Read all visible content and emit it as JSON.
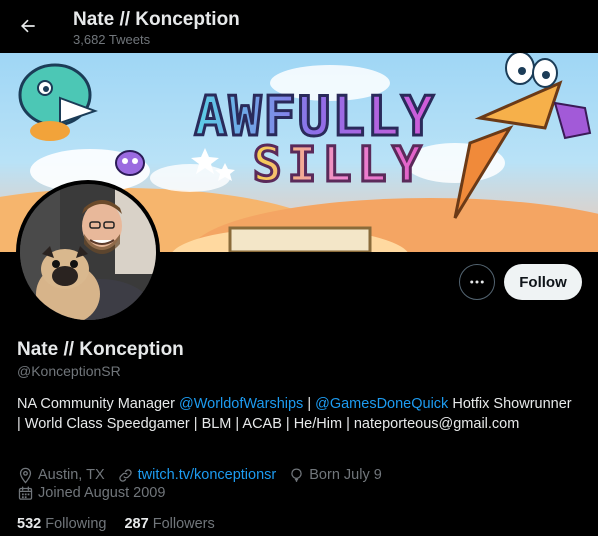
{
  "header": {
    "title": "Nate // Konception",
    "tweet_count": "3,682 Tweets"
  },
  "banner": {
    "line1": "AWFULLY",
    "line2": "SILLY"
  },
  "actions": {
    "follow_label": "Follow"
  },
  "profile": {
    "display_name": "Nate // Konception",
    "handle": "@KonceptionSR",
    "bio": {
      "part1": "NA Community Manager ",
      "mention1": "@WorldofWarships",
      "part2": " | ",
      "mention2": "@GamesDoneQuick",
      "part3": " Hotfix Showrunner | World Class Speedgamer | BLM | ACAB | He/Him | nateporteous@gmail.com"
    },
    "location": "Austin, TX",
    "website": "twitch.tv/konceptionsr",
    "birthday": "Born July 9",
    "joined": "Joined August 2009",
    "following_count": "532",
    "following_label": "Following",
    "followers_count": "287",
    "followers_label": "Followers"
  },
  "colors": {
    "background": "#000000",
    "text": "#e7e9ea",
    "secondary": "#71767b",
    "accent": "#1d9bf0",
    "follow_bg": "#eff3f4"
  },
  "icons": [
    "back-arrow-icon",
    "more-icon",
    "location-icon",
    "link-icon",
    "balloon-icon",
    "calendar-icon"
  ]
}
